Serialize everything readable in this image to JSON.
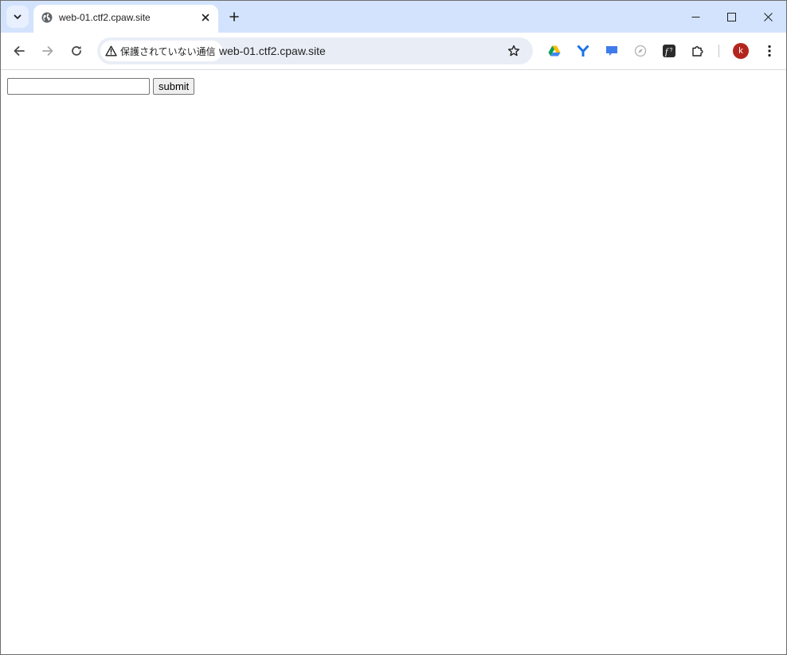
{
  "tab": {
    "title": "web-01.ctf2.cpaw.site"
  },
  "omnibox": {
    "security_label": "保護されていない通信",
    "url": "web-01.ctf2.cpaw.site"
  },
  "profile": {
    "initial": "k"
  },
  "icons": {
    "tab_search": "chevron-down-icon",
    "favicon": "globe-icon",
    "tab_close": "close-icon",
    "new_tab": "plus-icon",
    "minimize": "minimize-icon",
    "maximize": "maximize-icon",
    "close_window": "close-icon",
    "back": "arrow-left-icon",
    "forward": "arrow-right-icon",
    "reload": "reload-icon",
    "security": "warning-icon",
    "bookmark": "star-icon",
    "extensions": [
      "google-drive-icon",
      "yodel-icon",
      "chat-bubble-icon",
      "compass-icon",
      "function-icon",
      "puzzle-icon"
    ],
    "menu": "kebab-menu-icon"
  },
  "form": {
    "input_value": "",
    "submit_label": "submit"
  },
  "colors": {
    "tabstrip": "#d3e3fd",
    "omnibox": "#e9eef6",
    "avatar": "#b3261e"
  }
}
